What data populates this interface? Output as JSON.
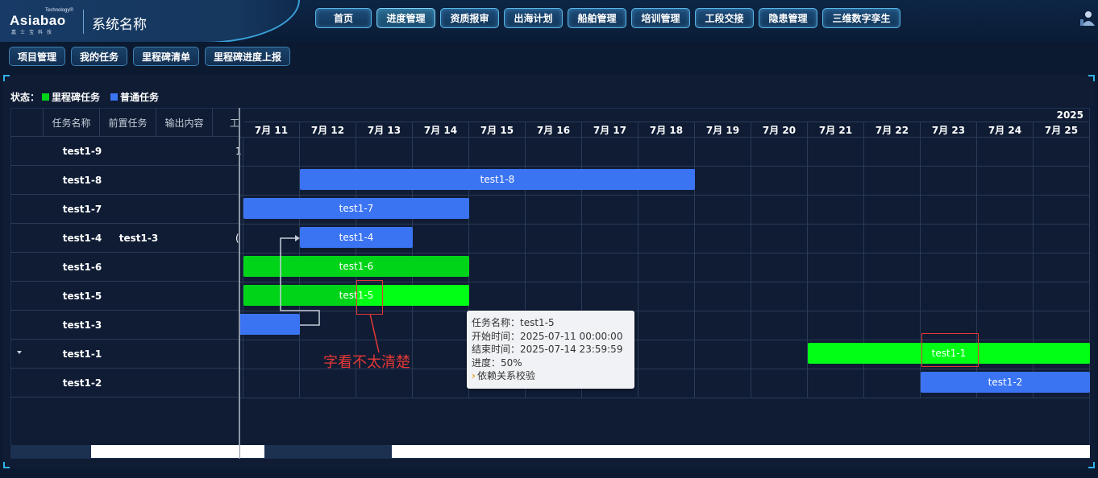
{
  "brand": {
    "logo_text": "Asiabao",
    "logo_tech": "Technology®",
    "logo_sub": "嘉士宝科技",
    "system_name": "系统名称"
  },
  "nav": [
    {
      "label": "首页",
      "active": false
    },
    {
      "label": "进度管理",
      "active": true
    },
    {
      "label": "资质报审",
      "active": false
    },
    {
      "label": "出海计划",
      "active": false
    },
    {
      "label": "船舶管理",
      "active": false
    },
    {
      "label": "培训管理",
      "active": false
    },
    {
      "label": "工段交接",
      "active": false
    },
    {
      "label": "隐患管理",
      "active": false
    },
    {
      "label": "三维数字孪生",
      "active": false
    }
  ],
  "sub_nav": [
    "项目管理",
    "我的任务",
    "里程碑清单",
    "里程碑进度上报"
  ],
  "legend": {
    "title": "状态：",
    "items": [
      {
        "label": "里程碑任务",
        "color": "#00d419"
      },
      {
        "label": "普通任务",
        "color": "#3b74f2"
      }
    ]
  },
  "table": {
    "columns": [
      "任务名称",
      "前置任务",
      "输出内容",
      "工"
    ],
    "rows": [
      {
        "name": "test1-9",
        "pre": "",
        "tail": "1"
      },
      {
        "name": "test1-8",
        "pre": "",
        "tail": ""
      },
      {
        "name": "test1-7",
        "pre": "",
        "tail": ""
      },
      {
        "name": "test1-4",
        "pre": "test1-3",
        "tail": "("
      },
      {
        "name": "test1-6",
        "pre": "",
        "tail": ""
      },
      {
        "name": "test1-5",
        "pre": "",
        "tail": ""
      },
      {
        "name": "test1-3",
        "pre": "",
        "tail": ""
      },
      {
        "name": "test1-1",
        "pre": "",
        "tail": "",
        "expandable": true
      },
      {
        "name": "test1-2",
        "pre": "",
        "tail": ""
      }
    ]
  },
  "timeline": {
    "year": "2025",
    "dates": [
      "7月 11",
      "7月 12",
      "7月 13",
      "7月 14",
      "7月 15",
      "7月 16",
      "7月 17",
      "7月 18",
      "7月 19",
      "7月 20",
      "7月 21",
      "7月 22",
      "7月 23",
      "7月 24",
      "7月 25"
    ]
  },
  "bars": [
    {
      "label": "test1-8",
      "row": 1,
      "type": "normal"
    },
    {
      "label": "test1-7",
      "row": 2,
      "type": "normal"
    },
    {
      "label": "test1-4",
      "row": 3,
      "type": "normal"
    },
    {
      "label": "test1-6",
      "row": 4,
      "type": "milestone"
    },
    {
      "label": "test1-5",
      "row": 5,
      "type": "milestone",
      "progress": 0.5
    },
    {
      "label": "",
      "row": 6,
      "type": "normal"
    },
    {
      "label": "test1-1",
      "row": 7,
      "type": "milestone"
    },
    {
      "label": "test1-2",
      "row": 8,
      "type": "normal"
    }
  ],
  "tooltip": {
    "name": "任务名称：test1-5",
    "start": "开始时间：2025-07-11 00:00:00",
    "end": "结束时间：2025-07-14 23:59:59",
    "progress": "进度：50%",
    "check": "依赖关系校验"
  },
  "annotation": {
    "text": "字看不太清楚",
    "color": "#e53935"
  }
}
